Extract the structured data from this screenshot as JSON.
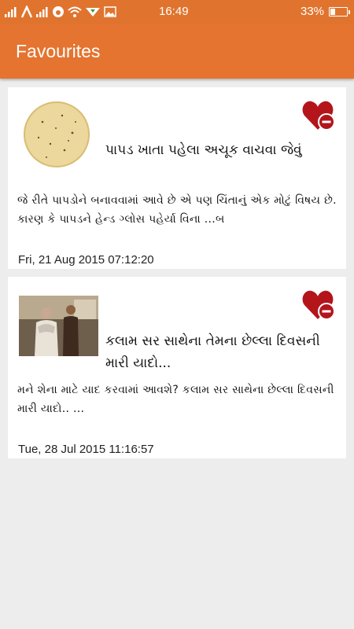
{
  "status_bar": {
    "time": "16:49",
    "battery": "33%",
    "battery_level": 0.33
  },
  "app_bar": {
    "title": "Favourites"
  },
  "favourites": [
    {
      "title": "પાપડ ખાતા પહેલા અચૂક વાચવા જેવું",
      "snippet": "જે રીતે પાપડોને બનાવવામાં આવે છે એ પણ ચિંતાનું એક મોટું વિષય છે. કારણ કે પાપડને હેન્ડ ગ્લોસ પહેર્યા વિના ...બ",
      "date": "Fri, 21 Aug 2015 07:12:20",
      "thumbnail": "papad-photo",
      "action_icon": "heart-remove-icon"
    },
    {
      "title": "કલામ સર સાથેના તેમના છેલ્લા દિવસની મારી યાદો...",
      "snippet": "મને શેના માટે યાદ કરવામાં આવશે? કલામ સર સાથેના છેલ્લા દિવસની મારી યાદો.. ...",
      "date": "Tue, 28 Jul 2015 11:16:57",
      "thumbnail": "people-photo",
      "action_icon": "heart-remove-icon"
    }
  ],
  "colors": {
    "accent": "#e47430",
    "heart": "#b3151b",
    "background": "#ededed"
  }
}
